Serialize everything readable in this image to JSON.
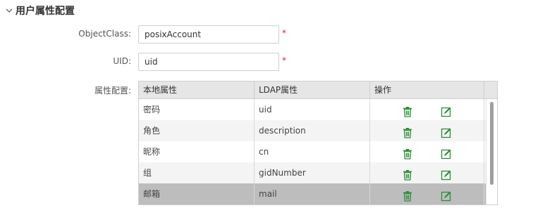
{
  "section": {
    "title": "用户属性配置",
    "icon": "chevron-down-icon"
  },
  "form": {
    "object_class": {
      "label": "ObjectClass:",
      "value": "posixAccount",
      "required_mark": "*"
    },
    "uid": {
      "label": "UID:",
      "value": "uid",
      "required_mark": "*"
    },
    "attr_config_label": "属性配置:"
  },
  "table": {
    "columns": [
      "本地属性",
      "LDAP属性",
      "操作"
    ],
    "rows": [
      {
        "local": "密码",
        "ldap": "uid"
      },
      {
        "local": "角色",
        "ldap": "description"
      },
      {
        "local": "昵称",
        "ldap": "cn"
      },
      {
        "local": "组",
        "ldap": "gidNumber"
      },
      {
        "local": "邮箱",
        "ldap": "mail"
      }
    ],
    "selected_row": 4,
    "icons": {
      "delete": "trash-icon",
      "edit": "edit-icon"
    }
  },
  "colors": {
    "accent_green": "#2e8b3d",
    "required_red": "#e02424",
    "selected_row": "#bdbdbd"
  }
}
